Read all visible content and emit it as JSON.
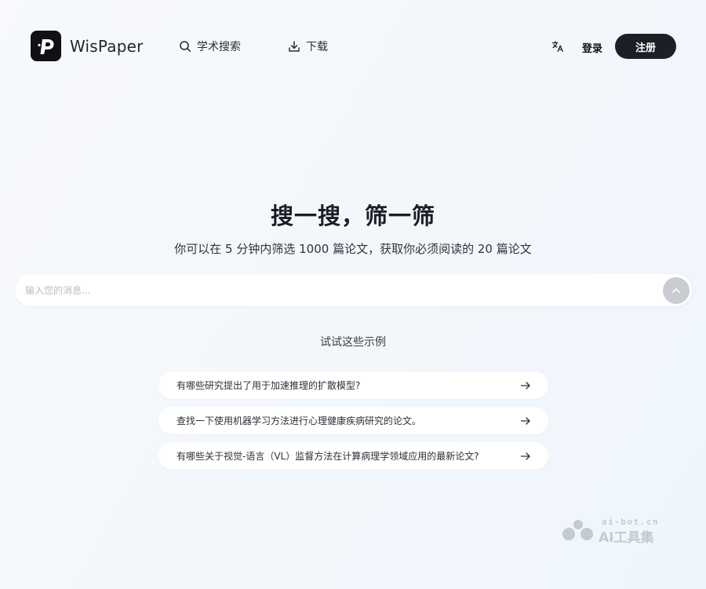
{
  "header": {
    "logo_text": "WisPaper",
    "nav": {
      "search_label": "学术搜索",
      "download_label": "下载"
    },
    "translate_icon": "translate-icon",
    "login_label": "登录",
    "register_label": "注册"
  },
  "hero": {
    "title": "搜一搜，筛一筛",
    "subtitle": "你可以在 5 分钟内筛选 1000 篇论文，获取你必须阅读的 20 篇论文"
  },
  "search": {
    "placeholder": "输入您的消息...",
    "value": "",
    "send_icon": "arrow-up-icon"
  },
  "examples": {
    "heading": "试试这些示例",
    "items": [
      {
        "text": "有哪些研究提出了用于加速推理的扩散模型?"
      },
      {
        "text": "查找一下使用机器学习方法进行心理健康疾病研究的论文。"
      },
      {
        "text": "有哪些关于视觉-语言（VL）监督方法在计算病理学领域应用的最新论文?"
      }
    ]
  },
  "watermark": {
    "domain": "ai-bot.cn",
    "brand": "AI工具集"
  },
  "colors": {
    "primary_dark": "#1c1f26",
    "send_button": "#c9ccd1",
    "background": "#f3f7fb"
  }
}
